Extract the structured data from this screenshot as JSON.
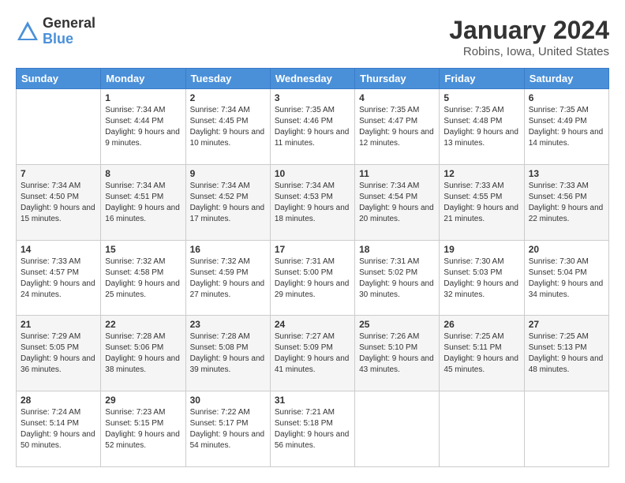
{
  "logo": {
    "general": "General",
    "blue": "Blue"
  },
  "header": {
    "month": "January 2024",
    "location": "Robins, Iowa, United States"
  },
  "weekdays": [
    "Sunday",
    "Monday",
    "Tuesday",
    "Wednesday",
    "Thursday",
    "Friday",
    "Saturday"
  ],
  "weeks": [
    [
      {
        "day": "",
        "sunrise": "",
        "sunset": "",
        "daylight": ""
      },
      {
        "day": "1",
        "sunrise": "Sunrise: 7:34 AM",
        "sunset": "Sunset: 4:44 PM",
        "daylight": "Daylight: 9 hours and 9 minutes."
      },
      {
        "day": "2",
        "sunrise": "Sunrise: 7:34 AM",
        "sunset": "Sunset: 4:45 PM",
        "daylight": "Daylight: 9 hours and 10 minutes."
      },
      {
        "day": "3",
        "sunrise": "Sunrise: 7:35 AM",
        "sunset": "Sunset: 4:46 PM",
        "daylight": "Daylight: 9 hours and 11 minutes."
      },
      {
        "day": "4",
        "sunrise": "Sunrise: 7:35 AM",
        "sunset": "Sunset: 4:47 PM",
        "daylight": "Daylight: 9 hours and 12 minutes."
      },
      {
        "day": "5",
        "sunrise": "Sunrise: 7:35 AM",
        "sunset": "Sunset: 4:48 PM",
        "daylight": "Daylight: 9 hours and 13 minutes."
      },
      {
        "day": "6",
        "sunrise": "Sunrise: 7:35 AM",
        "sunset": "Sunset: 4:49 PM",
        "daylight": "Daylight: 9 hours and 14 minutes."
      }
    ],
    [
      {
        "day": "7",
        "sunrise": "Sunrise: 7:34 AM",
        "sunset": "Sunset: 4:50 PM",
        "daylight": "Daylight: 9 hours and 15 minutes."
      },
      {
        "day": "8",
        "sunrise": "Sunrise: 7:34 AM",
        "sunset": "Sunset: 4:51 PM",
        "daylight": "Daylight: 9 hours and 16 minutes."
      },
      {
        "day": "9",
        "sunrise": "Sunrise: 7:34 AM",
        "sunset": "Sunset: 4:52 PM",
        "daylight": "Daylight: 9 hours and 17 minutes."
      },
      {
        "day": "10",
        "sunrise": "Sunrise: 7:34 AM",
        "sunset": "Sunset: 4:53 PM",
        "daylight": "Daylight: 9 hours and 18 minutes."
      },
      {
        "day": "11",
        "sunrise": "Sunrise: 7:34 AM",
        "sunset": "Sunset: 4:54 PM",
        "daylight": "Daylight: 9 hours and 20 minutes."
      },
      {
        "day": "12",
        "sunrise": "Sunrise: 7:33 AM",
        "sunset": "Sunset: 4:55 PM",
        "daylight": "Daylight: 9 hours and 21 minutes."
      },
      {
        "day": "13",
        "sunrise": "Sunrise: 7:33 AM",
        "sunset": "Sunset: 4:56 PM",
        "daylight": "Daylight: 9 hours and 22 minutes."
      }
    ],
    [
      {
        "day": "14",
        "sunrise": "Sunrise: 7:33 AM",
        "sunset": "Sunset: 4:57 PM",
        "daylight": "Daylight: 9 hours and 24 minutes."
      },
      {
        "day": "15",
        "sunrise": "Sunrise: 7:32 AM",
        "sunset": "Sunset: 4:58 PM",
        "daylight": "Daylight: 9 hours and 25 minutes."
      },
      {
        "day": "16",
        "sunrise": "Sunrise: 7:32 AM",
        "sunset": "Sunset: 4:59 PM",
        "daylight": "Daylight: 9 hours and 27 minutes."
      },
      {
        "day": "17",
        "sunrise": "Sunrise: 7:31 AM",
        "sunset": "Sunset: 5:00 PM",
        "daylight": "Daylight: 9 hours and 29 minutes."
      },
      {
        "day": "18",
        "sunrise": "Sunrise: 7:31 AM",
        "sunset": "Sunset: 5:02 PM",
        "daylight": "Daylight: 9 hours and 30 minutes."
      },
      {
        "day": "19",
        "sunrise": "Sunrise: 7:30 AM",
        "sunset": "Sunset: 5:03 PM",
        "daylight": "Daylight: 9 hours and 32 minutes."
      },
      {
        "day": "20",
        "sunrise": "Sunrise: 7:30 AM",
        "sunset": "Sunset: 5:04 PM",
        "daylight": "Daylight: 9 hours and 34 minutes."
      }
    ],
    [
      {
        "day": "21",
        "sunrise": "Sunrise: 7:29 AM",
        "sunset": "Sunset: 5:05 PM",
        "daylight": "Daylight: 9 hours and 36 minutes."
      },
      {
        "day": "22",
        "sunrise": "Sunrise: 7:28 AM",
        "sunset": "Sunset: 5:06 PM",
        "daylight": "Daylight: 9 hours and 38 minutes."
      },
      {
        "day": "23",
        "sunrise": "Sunrise: 7:28 AM",
        "sunset": "Sunset: 5:08 PM",
        "daylight": "Daylight: 9 hours and 39 minutes."
      },
      {
        "day": "24",
        "sunrise": "Sunrise: 7:27 AM",
        "sunset": "Sunset: 5:09 PM",
        "daylight": "Daylight: 9 hours and 41 minutes."
      },
      {
        "day": "25",
        "sunrise": "Sunrise: 7:26 AM",
        "sunset": "Sunset: 5:10 PM",
        "daylight": "Daylight: 9 hours and 43 minutes."
      },
      {
        "day": "26",
        "sunrise": "Sunrise: 7:25 AM",
        "sunset": "Sunset: 5:11 PM",
        "daylight": "Daylight: 9 hours and 45 minutes."
      },
      {
        "day": "27",
        "sunrise": "Sunrise: 7:25 AM",
        "sunset": "Sunset: 5:13 PM",
        "daylight": "Daylight: 9 hours and 48 minutes."
      }
    ],
    [
      {
        "day": "28",
        "sunrise": "Sunrise: 7:24 AM",
        "sunset": "Sunset: 5:14 PM",
        "daylight": "Daylight: 9 hours and 50 minutes."
      },
      {
        "day": "29",
        "sunrise": "Sunrise: 7:23 AM",
        "sunset": "Sunset: 5:15 PM",
        "daylight": "Daylight: 9 hours and 52 minutes."
      },
      {
        "day": "30",
        "sunrise": "Sunrise: 7:22 AM",
        "sunset": "Sunset: 5:17 PM",
        "daylight": "Daylight: 9 hours and 54 minutes."
      },
      {
        "day": "31",
        "sunrise": "Sunrise: 7:21 AM",
        "sunset": "Sunset: 5:18 PM",
        "daylight": "Daylight: 9 hours and 56 minutes."
      },
      {
        "day": "",
        "sunrise": "",
        "sunset": "",
        "daylight": ""
      },
      {
        "day": "",
        "sunrise": "",
        "sunset": "",
        "daylight": ""
      },
      {
        "day": "",
        "sunrise": "",
        "sunset": "",
        "daylight": ""
      }
    ]
  ]
}
